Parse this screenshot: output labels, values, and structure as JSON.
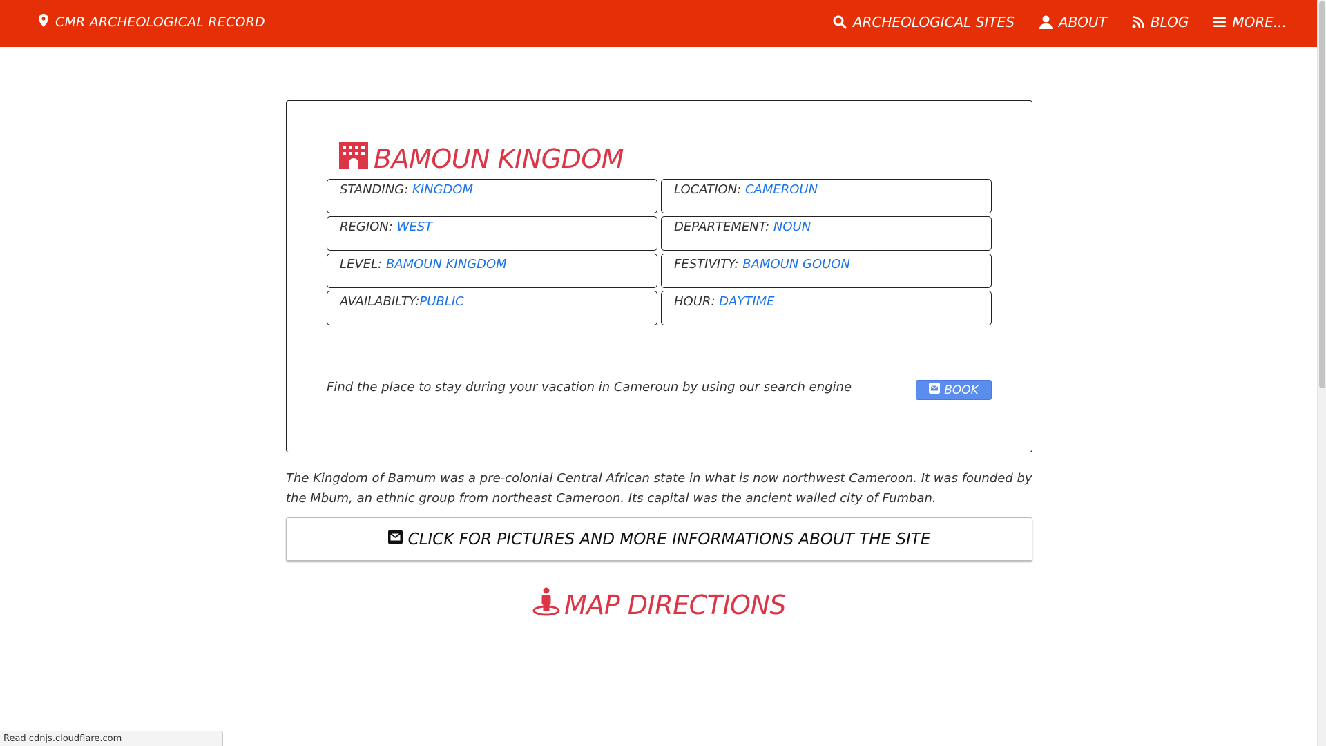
{
  "navbar": {
    "brand_label": "CMR ARCHEOLOGICAL RECORD",
    "brand_icon": "map-marker-icon",
    "links": [
      {
        "label": "ARCHEOLOGICAL SITES",
        "icon": "search-icon"
      },
      {
        "label": "ABOUT",
        "icon": "user-icon"
      },
      {
        "label": "BLOG",
        "icon": "rss-icon"
      },
      {
        "label": "MORE...",
        "icon": "bars-icon"
      }
    ],
    "background_color": "#e52f06"
  },
  "site": {
    "title": "BAMOUN KINGDOM",
    "title_icon": "building-icon",
    "fields": [
      {
        "label": "STANDING: ",
        "value": "KINGDOM"
      },
      {
        "label": "LOCATION: ",
        "value": "CAMEROUN"
      },
      {
        "label": "REGION: ",
        "value": "WEST"
      },
      {
        "label": "DEPARTEMENT: ",
        "value": "NOUN"
      },
      {
        "label": "LEVEL: ",
        "value": "BAMOUN KINGDOM"
      },
      {
        "label": "FESTIVITY: ",
        "value": "BAMOUN GOUON"
      },
      {
        "label": "AVAILABILTY:",
        "value": "PUBLIC"
      },
      {
        "label": "HOUR: ",
        "value": "DAYTIME"
      }
    ],
    "promo_text": "Find the place to stay during your vacation in Cameroun by using our search engine",
    "book_label": "BOOK",
    "book_icon": "envelope-square-icon",
    "accent_color": "#dc3545",
    "value_color": "#1a73e8"
  },
  "description": "The Kingdom of Bamum was a pre-colonial Central African state in what is now northwest Cameroon. It was founded by the Mbum, an ethnic group from northeast Cameroon. Its capital was the ancient walled city of Fumban.",
  "more_info": {
    "label": "CLICK FOR PICTURES AND MORE INFORMATIONS ABOUT THE SITE",
    "icon": "envelope-square-icon"
  },
  "map": {
    "heading": "MAP DIRECTIONS",
    "icon": "street-view-icon"
  },
  "status_bar": {
    "text": "Read cdnjs.cloudflare.com"
  }
}
